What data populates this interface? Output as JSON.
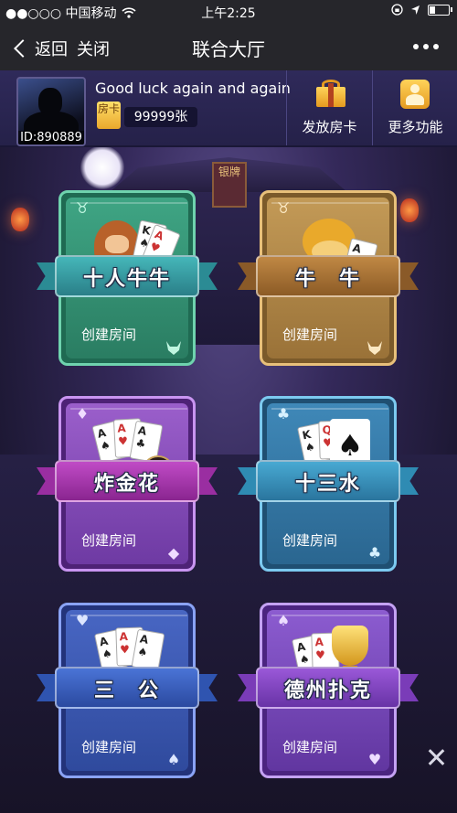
{
  "status_bar": {
    "carrier": "●●○○○ 中国移动",
    "time": "上午2:25",
    "battery_level": 0.35
  },
  "nav": {
    "back_label": "返回",
    "close_label": "关闭",
    "title": "联合大厅"
  },
  "user": {
    "id_label": "ID:890889",
    "motto": "Good luck again and again",
    "room_card_icon_label": "房卡",
    "room_card_count": "99999张"
  },
  "top_buttons": {
    "send_card": "发放房卡",
    "more_functions": "更多功能"
  },
  "games": [
    {
      "name": "十人牛牛",
      "action": "创建房间",
      "theme": "green",
      "corner_icon": "bull-icon"
    },
    {
      "name": "牛　牛",
      "action": "创建房间",
      "theme": "gold",
      "corner_icon": "bull-icon"
    },
    {
      "name": "炸金花",
      "action": "创建房间",
      "theme": "purple",
      "corner_icon": "diamond-icon"
    },
    {
      "name": "十三水",
      "action": "创建房间",
      "theme": "teal",
      "corner_icon": "club-icon"
    },
    {
      "name": "三　公",
      "action": "创建房间",
      "theme": "blue",
      "corner_icon": "spade-icon"
    },
    {
      "name": "德州扑克",
      "action": "创建房间",
      "theme": "violet",
      "corner_icon": "spade-icon"
    }
  ],
  "temple_sign": "银牌",
  "colors": {
    "green": "#2f8b6e",
    "gold": "#a77a39",
    "purple": "#7b3fa8",
    "teal": "#2f6e9a",
    "blue": "#2f4a9d",
    "violet": "#6e3aa3"
  }
}
